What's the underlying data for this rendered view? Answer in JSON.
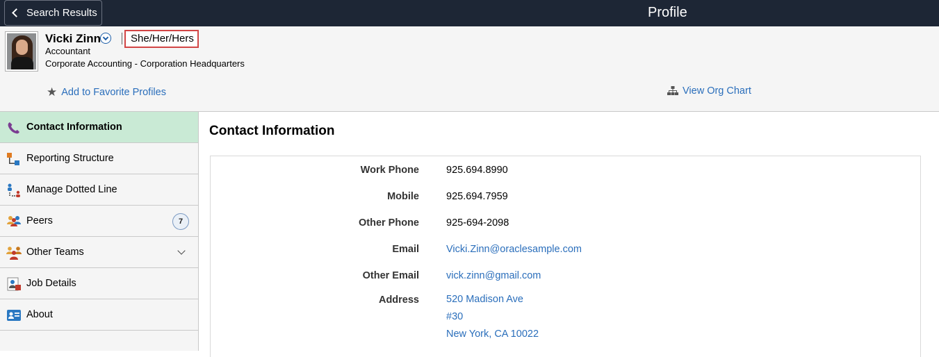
{
  "topbar": {
    "back_label": "Search Results",
    "title": "Profile"
  },
  "person": {
    "name": "Vicki Zinn",
    "pronouns": "She/Her/Hers",
    "job_title": "Accountant",
    "department": "Corporate Accounting - Corporation Headquarters"
  },
  "actions": {
    "favorite_label": "Add to Favorite Profiles",
    "org_chart_label": "View Org Chart"
  },
  "sidebar": {
    "items": [
      {
        "label": "Contact Information",
        "icon": "phone-icon",
        "selected": true
      },
      {
        "label": "Reporting Structure",
        "icon": "hierarchy-icon"
      },
      {
        "label": "Manage Dotted Line",
        "icon": "dotted-line-icon"
      },
      {
        "label": "Peers",
        "icon": "peers-icon",
        "badge": "7"
      },
      {
        "label": "Other Teams",
        "icon": "teams-icon",
        "expandable": true
      },
      {
        "label": "Job Details",
        "icon": "job-details-icon"
      },
      {
        "label": "About",
        "icon": "id-card-icon"
      }
    ]
  },
  "main": {
    "title": "Contact Information",
    "fields": {
      "work_phone": {
        "label": "Work Phone",
        "value": "925.694.8990"
      },
      "mobile": {
        "label": "Mobile",
        "value": "925.694.7959"
      },
      "other_phone": {
        "label": "Other Phone",
        "value": "925-694-2098"
      },
      "email": {
        "label": "Email",
        "value": "Vicki.Zinn@oraclesample.com"
      },
      "other_email": {
        "label": "Other Email",
        "value": "vick.zinn@gmail.com"
      },
      "address": {
        "label": "Address",
        "line1": "520 Madison Ave",
        "line2": "#30",
        "line3": "New York, CA 10022"
      }
    }
  },
  "colors": {
    "topbar": "#1d2635",
    "link": "#2a6ebb",
    "selected_nav": "#c9ead5",
    "highlight_box": "#d24545"
  }
}
